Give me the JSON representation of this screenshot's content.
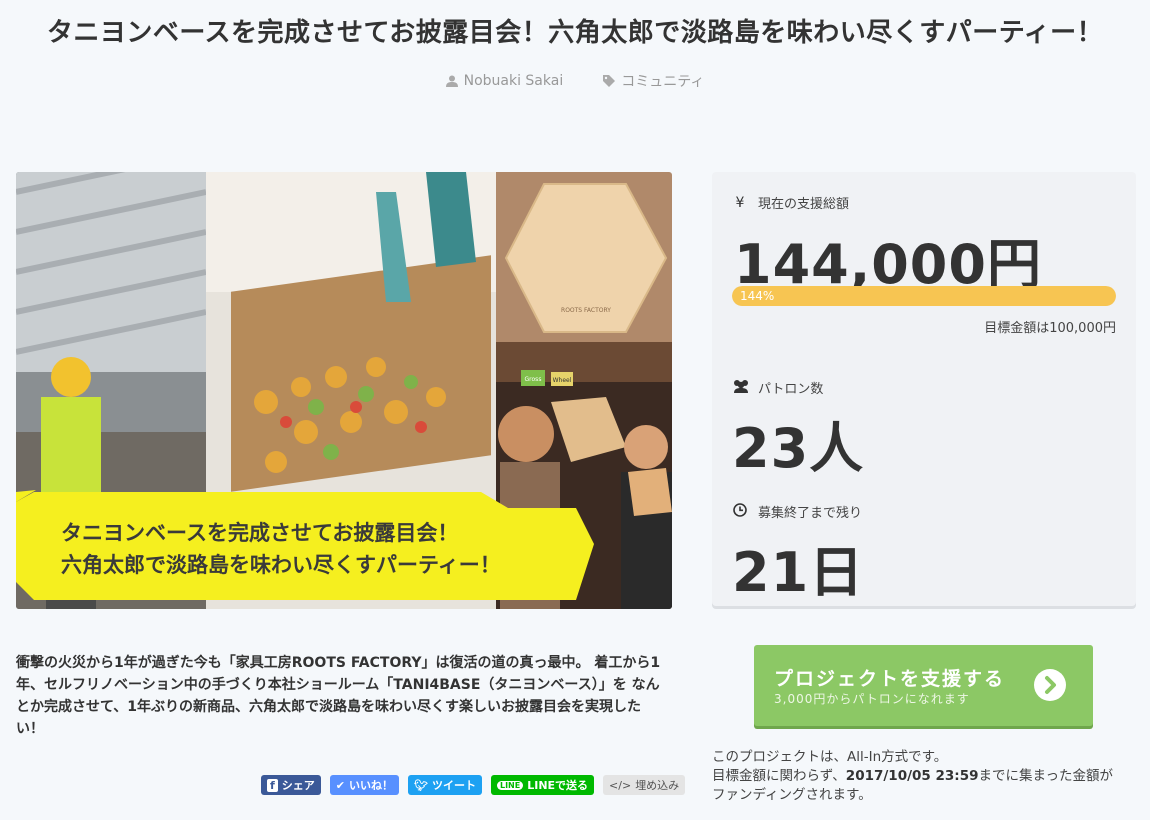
{
  "header": {
    "title": "タニヨンベースを完成させてお披露目会！六角太郎で淡路島を味わい尽くすパーティー！",
    "author": "Nobuaki Sakai",
    "category": "コミュニティ"
  },
  "hero": {
    "banner_line1": "タニヨンベースを完成させてお披露目会！",
    "banner_line2": "六角太郎で淡路島を味わい尽くすパーティー！",
    "product_stamp": "ROOTS FACTORY",
    "shop_sign_1": "Gross",
    "shop_sign_2": "Wheel"
  },
  "stats": {
    "total_label": "現在の支援総額",
    "total_value": "144,000円",
    "progress_label": "144%",
    "progress_percent": 144,
    "goal_text": "目標金額は100,000円",
    "patrons_label": "パトロン数",
    "patrons_value": "23人",
    "remaining_label": "募集終了まで残り",
    "remaining_value": "21日"
  },
  "cta": {
    "main": "プロジェクトを支援する",
    "sub": "3,000円からパトロンになれます"
  },
  "allin": {
    "line1": "このプロジェクトは、All-In方式です。",
    "line2_pre": "目標金額に関わらず、",
    "deadline": "2017/10/05 23:59",
    "line2_post": "までに集まった金額が",
    "line3": "ファンディングされます。"
  },
  "description": "衝撃の火災から1年が過ぎた今も「家具工房ROOTS FACTORY」は復活の道の真っ最中。 着工から1年、セルフリノベーション中の手づくり本社ショールーム「TANI4BASE（タニヨンベース）」を なんとか完成させて、1年ぶりの新商品、六角太郎で淡路島を味わい尽くす楽しいお披露目会を実現したい！",
  "share": {
    "facebook": "シェア",
    "like": "いいね！",
    "tweet": "ツイート",
    "line": "LINEで送る",
    "embed": "埋め込み"
  },
  "colors": {
    "accent_green": "#8cc865",
    "progress_yellow": "#f7c552",
    "facebook": "#3b5998",
    "like": "#5890ff",
    "twitter": "#1da1f2",
    "line": "#00b900"
  },
  "icons": {
    "author": "user-icon",
    "category": "tag-icon",
    "total": "yen-icon",
    "patrons": "users-icon",
    "remaining": "clock-icon",
    "cta": "chevron-right-circle-icon"
  }
}
